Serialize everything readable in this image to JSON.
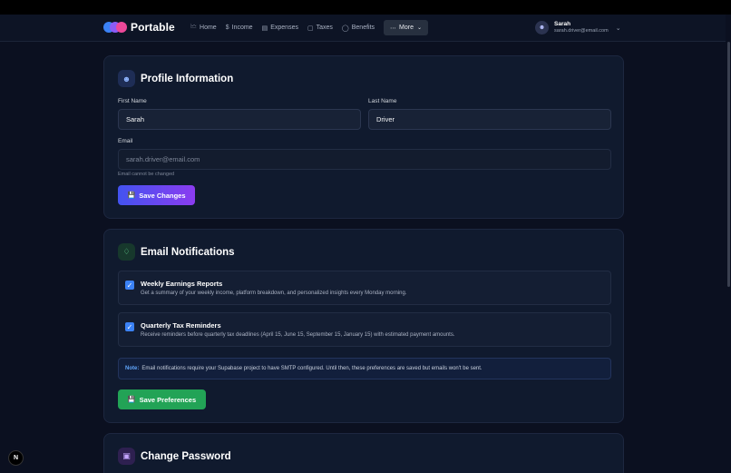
{
  "brand": {
    "name": "Portable"
  },
  "nav": {
    "items": [
      {
        "label": "Home",
        "icon": "chart-icon"
      },
      {
        "label": "Income",
        "icon": "dollar-icon"
      },
      {
        "label": "Expenses",
        "icon": "receipt-icon"
      },
      {
        "label": "Taxes",
        "icon": "document-icon"
      },
      {
        "label": "Benefits",
        "icon": "shield-icon"
      }
    ],
    "more_label": "More"
  },
  "user": {
    "name": "Sarah",
    "email": "sarah.driver@email.com"
  },
  "profile": {
    "title": "Profile Information",
    "first_name_label": "First Name",
    "first_name_value": "Sarah",
    "last_name_label": "Last Name",
    "last_name_value": "Driver",
    "email_label": "Email",
    "email_value": "sarah.driver@email.com",
    "email_hint": "Email cannot be changed",
    "save_label": "Save Changes"
  },
  "notifications": {
    "title": "Email Notifications",
    "weekly": {
      "title": "Weekly Earnings Reports",
      "description": "Get a summary of your weekly income, platform breakdown, and personalized insights every Monday morning.",
      "checked": true
    },
    "quarterly": {
      "title": "Quarterly Tax Reminders",
      "description": "Receive reminders before quarterly tax deadlines (April 15, June 15, September 15, January 15) with estimated payment amounts.",
      "checked": true
    },
    "note_label": "Note:",
    "note_text": "Email notifications require your Supabase project to have SMTP configured. Until then, these preferences are saved but emails won't be sent.",
    "save_label": "Save Preferences"
  },
  "password": {
    "title": "Change Password"
  },
  "dev_badge": {
    "label": "N"
  },
  "colors": {
    "background": "#0b1020",
    "card": "#101a2e",
    "accent_blue": "#3b82f6",
    "accent_purple": "#7c3aed",
    "success_green": "#22a356"
  }
}
